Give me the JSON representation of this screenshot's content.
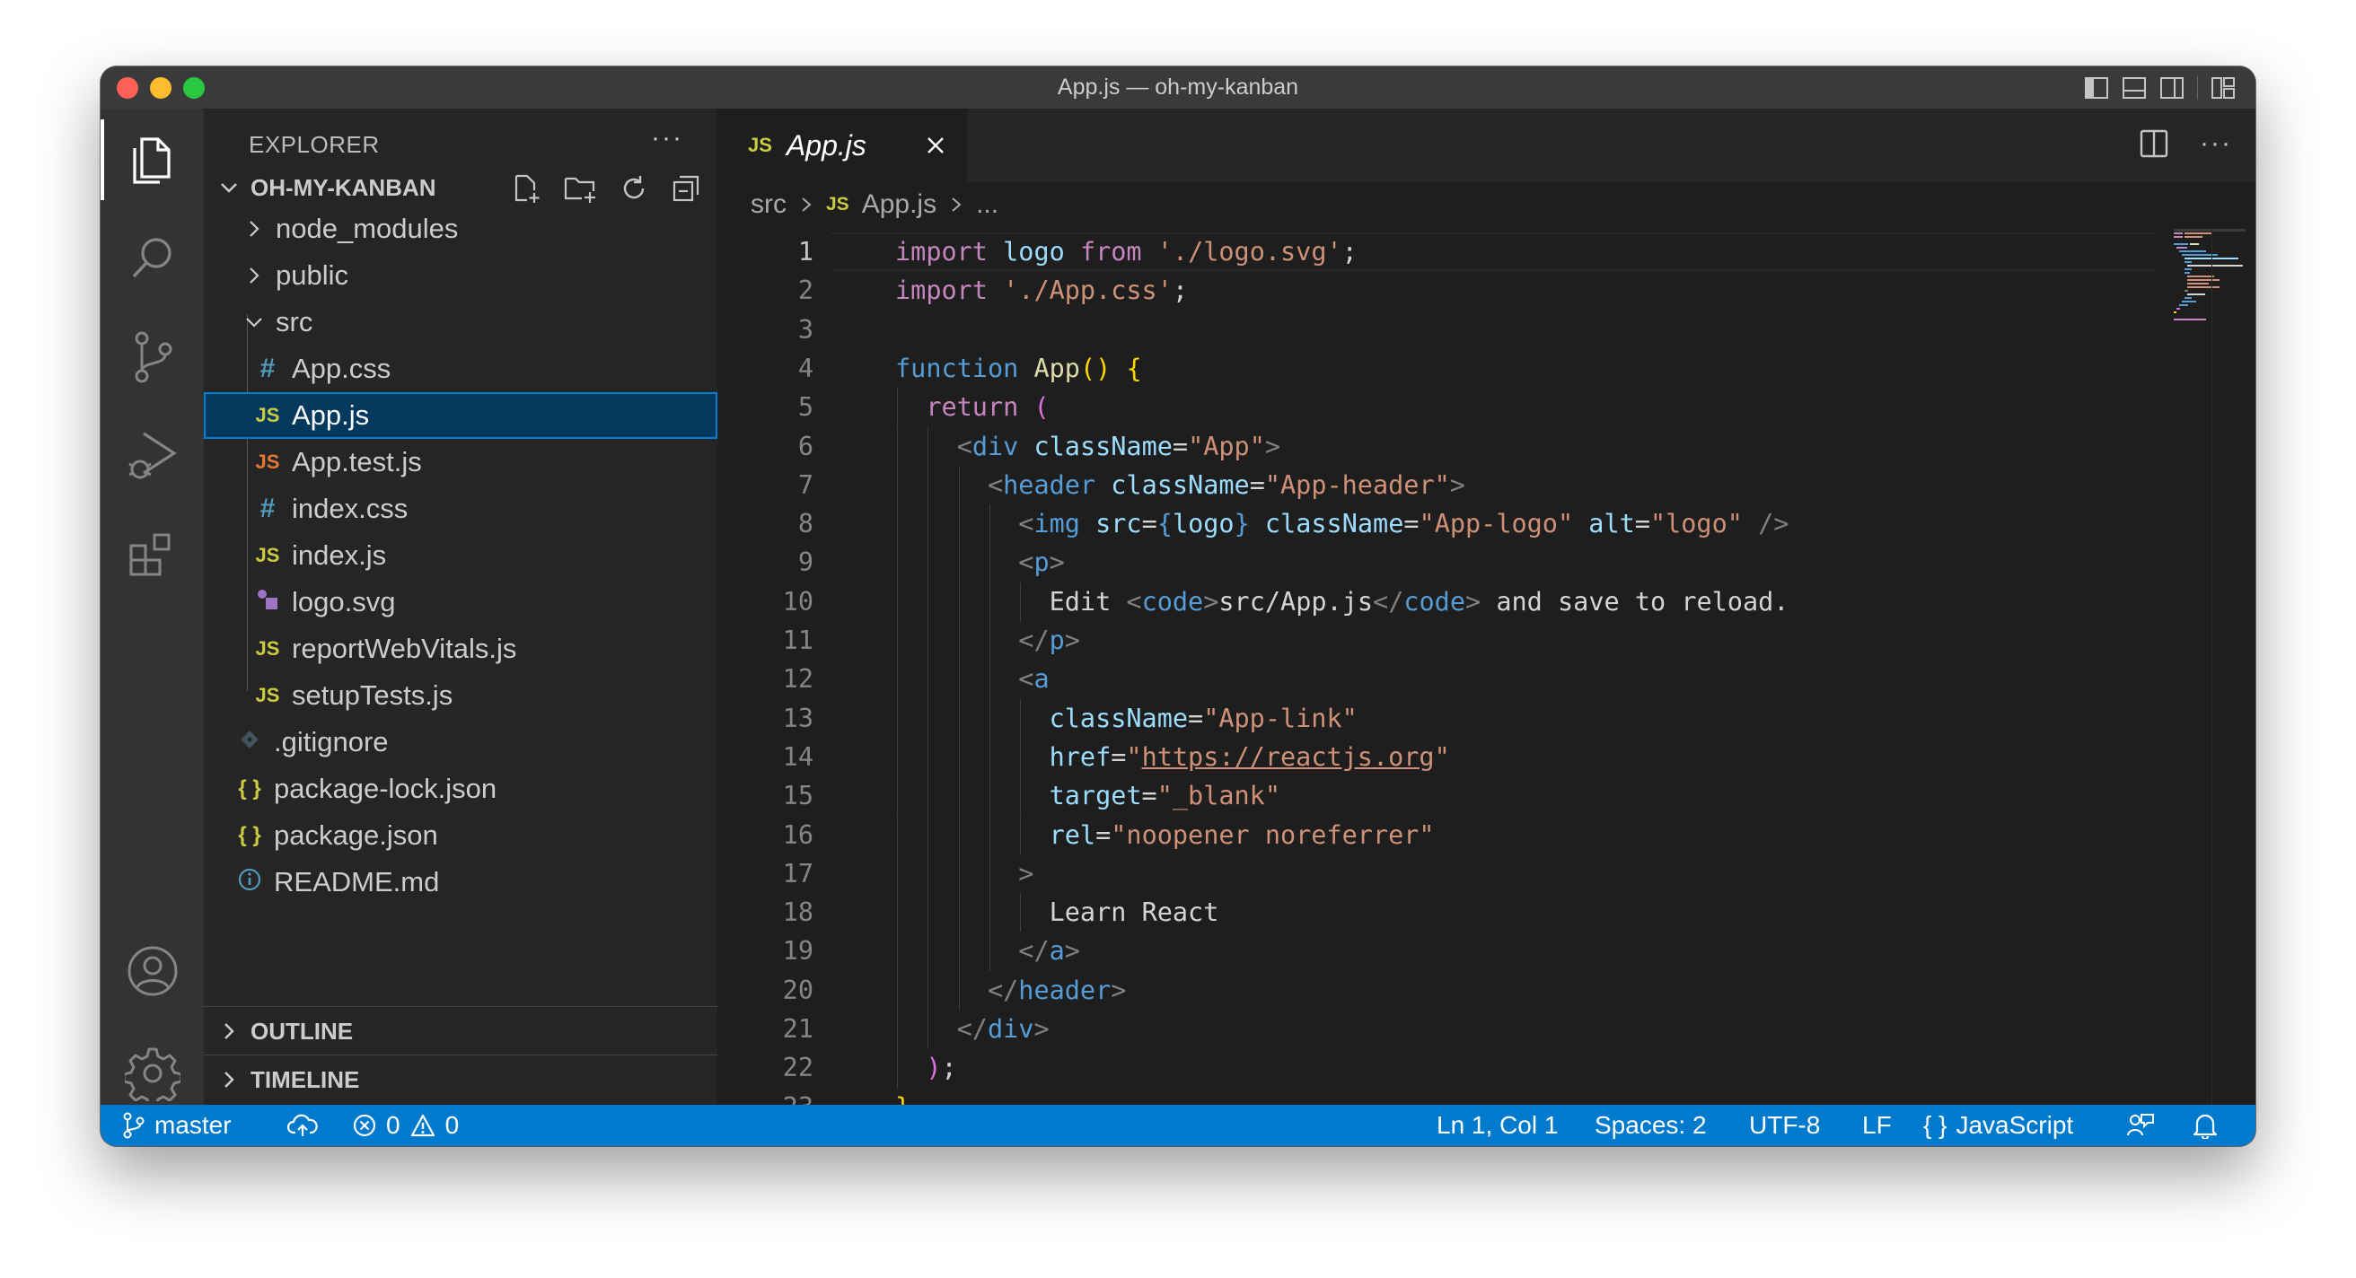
{
  "window": {
    "title": "App.js — oh-my-kanban"
  },
  "sidebar": {
    "title": "EXPLORER",
    "more": "···",
    "project": "OH-MY-KANBAN",
    "tree": [
      {
        "label": "node_modules",
        "kind": "folder"
      },
      {
        "label": "public",
        "kind": "folder"
      },
      {
        "label": "src",
        "kind": "folder-open"
      },
      {
        "label": "App.css",
        "kind": "css"
      },
      {
        "label": "App.js",
        "kind": "js"
      },
      {
        "label": "App.test.js",
        "kind": "test"
      },
      {
        "label": "index.css",
        "kind": "css"
      },
      {
        "label": "index.js",
        "kind": "js"
      },
      {
        "label": "logo.svg",
        "kind": "svg"
      },
      {
        "label": "reportWebVitals.js",
        "kind": "js"
      },
      {
        "label": "setupTests.js",
        "kind": "js"
      },
      {
        "label": ".gitignore",
        "kind": "git"
      },
      {
        "label": "package-lock.json",
        "kind": "json"
      },
      {
        "label": "package.json",
        "kind": "json"
      },
      {
        "label": "README.md",
        "kind": "info"
      }
    ],
    "icon_text": {
      "css": "#",
      "js": "JS",
      "json": "{ }",
      "info": "i"
    },
    "outline": "OUTLINE",
    "timeline": "TIMELINE"
  },
  "editor": {
    "tab": {
      "icon_text": "JS",
      "label": "App.js"
    },
    "breadcrumb": {
      "folder": "src",
      "icon_text": "JS",
      "file": "App.js",
      "tail": "..."
    },
    "current_line": 1
  },
  "code_lines": [
    "import logo from './logo.svg';",
    "import './App.css';",
    "",
    "function App() {",
    "  return (",
    "    <div className=\"App\">",
    "      <header className=\"App-header\">",
    "        <img src={logo} className=\"App-logo\" alt=\"logo\" />",
    "        <p>",
    "          Edit <code>src/App.js</code> and save to reload.",
    "        </p>",
    "        <a",
    "          className=\"App-link\"",
    "          href=\"https://reactjs.org\"",
    "          target=\"_blank\"",
    "          rel=\"noopener noreferrer\"",
    "        >",
    "          Learn React",
    "        </a>",
    "      </header>",
    "    </div>",
    "  );",
    "}"
  ],
  "statusbar": {
    "branch": "master",
    "errors": "0",
    "warnings": "0",
    "position": "Ln 1, Col 1",
    "spaces": "Spaces: 2",
    "encoding": "UTF-8",
    "eol": "LF",
    "language_icon": "{ }",
    "language": "JavaScript"
  },
  "colors": {
    "statusbar": "#007acc",
    "activitybar": "#333333",
    "sidebar": "#252526",
    "editor": "#1e1e1e",
    "selection": "#04395e",
    "js_icon": "#cbcb41",
    "css_icon": "#519aba",
    "test_icon": "#e37933"
  },
  "icons": {
    "activity": [
      "files-icon",
      "search-icon",
      "source-control-icon",
      "run-debug-icon",
      "extensions-icon",
      "accounts-icon",
      "settings-gear-icon"
    ]
  }
}
